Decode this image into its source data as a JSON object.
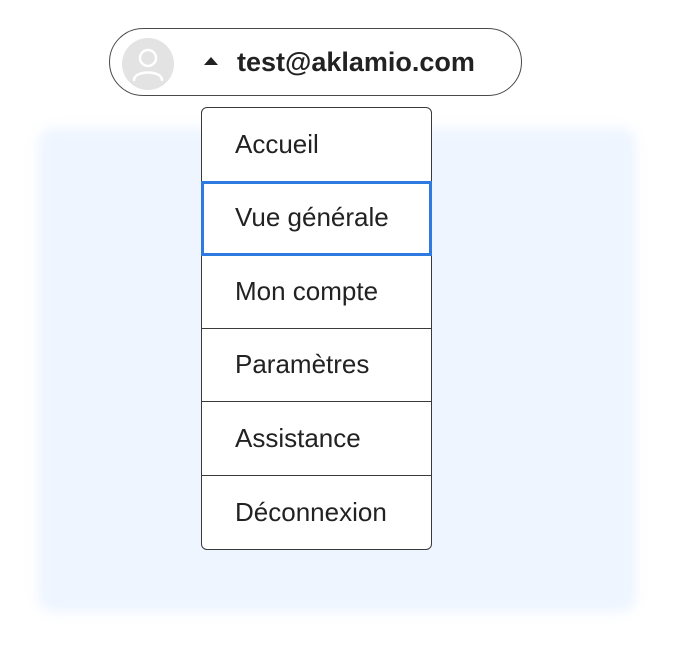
{
  "user": {
    "email": "test@aklamio.com",
    "avatar_icon": "user-avatar-icon",
    "toggle_icon": "caret-up-icon"
  },
  "menu": {
    "focused_index": 1,
    "items": [
      {
        "label": "Accueil"
      },
      {
        "label": "Vue générale"
      },
      {
        "label": "Mon compte"
      },
      {
        "label": "Paramètres"
      },
      {
        "label": "Assistance"
      },
      {
        "label": "Déconnexion"
      }
    ]
  },
  "colors": {
    "focus_ring": "#2f7ae0",
    "background_tint": "#eef5ff",
    "avatar_bg": "#e3e3e3",
    "text": "#222222"
  }
}
